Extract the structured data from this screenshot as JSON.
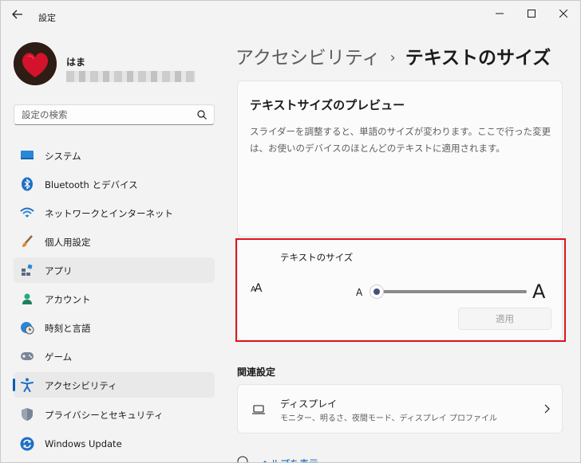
{
  "window": {
    "title": "設定"
  },
  "profile": {
    "name": "はま"
  },
  "search": {
    "placeholder": "設定の検索"
  },
  "sidebar": {
    "items": [
      {
        "label": "システム",
        "icon": "monitor-icon"
      },
      {
        "label": "Bluetooth とデバイス",
        "icon": "bluetooth-icon"
      },
      {
        "label": "ネットワークとインターネット",
        "icon": "wifi-icon"
      },
      {
        "label": "個人用設定",
        "icon": "brush-icon"
      },
      {
        "label": "アプリ",
        "icon": "apps-icon"
      },
      {
        "label": "アカウント",
        "icon": "person-icon"
      },
      {
        "label": "時刻と言語",
        "icon": "globe-clock-icon"
      },
      {
        "label": "ゲーム",
        "icon": "gamepad-icon"
      },
      {
        "label": "アクセシビリティ",
        "icon": "accessibility-icon"
      },
      {
        "label": "プライバシーとセキュリティ",
        "icon": "shield-icon"
      },
      {
        "label": "Windows Update",
        "icon": "update-icon"
      }
    ],
    "selected_index": 8,
    "accent": "#005fb8"
  },
  "breadcrumb": {
    "parent": "アクセシビリティ",
    "separator": "›",
    "current": "テキストのサイズ"
  },
  "preview": {
    "title": "テキストサイズのプレビュー",
    "body": "スライダーを調整すると、単語のサイズが変わります。ここで行った変更は、お使いのデバイスのほとんどのテキストに適用されます。"
  },
  "text_size": {
    "label": "テキストのサイズ",
    "aa_icon_text": "ᴬA",
    "small_a": "A",
    "big_a": "A",
    "slider_value_fraction": 0,
    "apply_label": "適用",
    "apply_enabled": false
  },
  "related": {
    "title": "関連設定",
    "display": {
      "title": "ディスプレイ",
      "description": "モニター、明るさ、夜間モード、ディスプレイ プロファイル"
    }
  },
  "help": {
    "label": "ヘルプを表示"
  },
  "colors": {
    "highlight_border": "#e0131b",
    "link": "#005fb8"
  }
}
